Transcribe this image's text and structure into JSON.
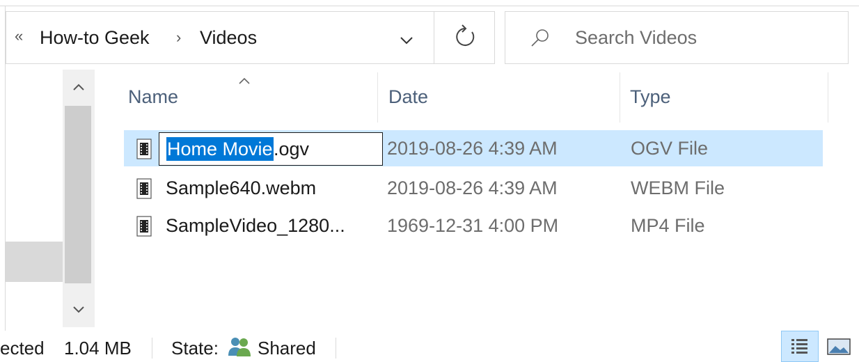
{
  "address_bar": {
    "overflow_chevrons": "«",
    "breadcrumbs": [
      "How-to Geek",
      "Videos"
    ],
    "separator": "›"
  },
  "search": {
    "placeholder": "Search Videos"
  },
  "columns": {
    "name": "Name",
    "date": "Date",
    "type": "Type"
  },
  "files": [
    {
      "name": "Home Movie.ogv",
      "rename_selected": "Home Movie",
      "rename_rest": ".ogv",
      "date": "2019-08-26 4:39 AM",
      "type": "OGV File",
      "selected": true,
      "renaming": true
    },
    {
      "name": "Sample640.webm",
      "date": "2019-08-26 4:39 AM",
      "type": "WEBM File",
      "selected": false
    },
    {
      "name": "SampleVideo_1280...",
      "date": "1969-12-31 4:00 PM",
      "type": "MP4 File",
      "selected": false
    }
  ],
  "status_bar": {
    "selected": "ected",
    "size": "1.04 MB",
    "state_label": "State:",
    "state_value": "Shared"
  },
  "colors": {
    "selection": "#cce8ff",
    "text_selection": "#0078d7",
    "header_text": "#4c607a"
  },
  "icons": {
    "file": "video-file-icon",
    "refresh": "refresh-icon",
    "search": "search-icon",
    "shared": "shared-users-icon"
  }
}
